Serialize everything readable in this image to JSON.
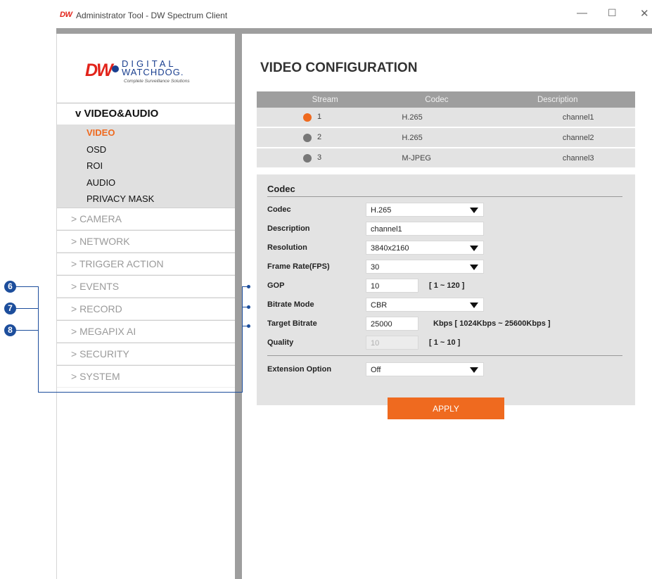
{
  "window": {
    "logo": "DW",
    "title": "Administrator Tool - DW Spectrum Client",
    "controls": {
      "minimize": "—",
      "maximize": "☐",
      "close": "✕"
    }
  },
  "brand": {
    "mark": "DW",
    "line1": "DIGITAL",
    "line2": "WATCHDOG.",
    "tagline": "Complete Surveillance Solutions"
  },
  "sidebar": {
    "open_section": "v VIDEO&AUDIO",
    "sub_items": [
      {
        "label": "VIDEO",
        "active": true
      },
      {
        "label": "OSD",
        "active": false
      },
      {
        "label": "ROI",
        "active": false
      },
      {
        "label": "AUDIO",
        "active": false
      },
      {
        "label": "PRIVACY MASK",
        "active": false
      }
    ],
    "items": [
      {
        "label": "> CAMERA"
      },
      {
        "label": "> NETWORK"
      },
      {
        "label": "> TRIGGER ACTION"
      },
      {
        "label": "> EVENTS"
      },
      {
        "label": "> RECORD"
      },
      {
        "label": "> MEGAPIX AI"
      },
      {
        "label": "> SECURITY"
      },
      {
        "label": "> SYSTEM"
      }
    ]
  },
  "main": {
    "title": "VIDEO CONFIGURATION",
    "table": {
      "headers": [
        "Stream",
        "Codec",
        "Description"
      ],
      "rows": [
        {
          "stream": "1",
          "codec": "H.265",
          "description": "channel1",
          "selected": true
        },
        {
          "stream": "2",
          "codec": "H.265",
          "description": "channel2",
          "selected": false
        },
        {
          "stream": "3",
          "codec": "M-JPEG",
          "description": "channel3",
          "selected": false
        }
      ]
    },
    "codec_section": {
      "title": "Codec",
      "fields": {
        "codec": {
          "label": "Codec",
          "value": "H.265"
        },
        "description": {
          "label": "Description",
          "value": "channel1"
        },
        "resolution": {
          "label": "Resolution",
          "value": "3840x2160"
        },
        "frame_rate": {
          "label": "Frame Rate(FPS)",
          "value": "30"
        },
        "gop": {
          "label": "GOP",
          "value": "10",
          "hint": "[ 1 ~ 120 ]"
        },
        "bitrate_mode": {
          "label": "Bitrate Mode",
          "value": "CBR"
        },
        "target_bitrate": {
          "label": "Target Bitrate",
          "value": "25000",
          "hint": "Kbps [ 1024Kbps ~ 25600Kbps ]"
        },
        "quality": {
          "label": "Quality",
          "value": "10",
          "hint": "[ 1 ~ 10 ]"
        },
        "extension": {
          "label": "Extension Option",
          "value": "Off"
        }
      }
    },
    "apply_label": "APPLY"
  },
  "callouts": [
    "6",
    "7",
    "8"
  ],
  "colors": {
    "accent": "#ef6a1f",
    "callout": "#1d4e9c",
    "panel": "#e3e3e3",
    "header": "#9e9e9e"
  }
}
